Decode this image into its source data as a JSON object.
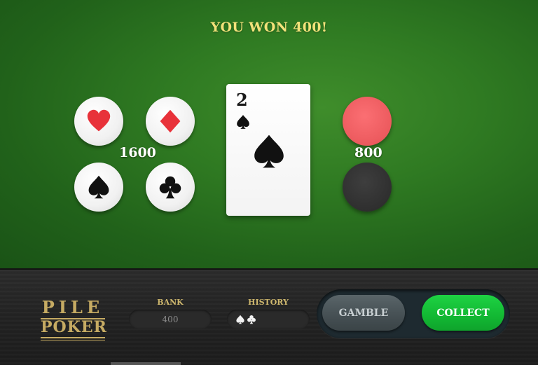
{
  "message": "YOU WON 400!",
  "suit_bet_value": "1600",
  "color_bet_value": "800",
  "suits": [
    {
      "name": "hearts",
      "icon": "heart-icon",
      "color": "#e8323a"
    },
    {
      "name": "diamonds",
      "icon": "diamond-icon",
      "color": "#e8323a"
    },
    {
      "name": "spades",
      "icon": "spade-icon",
      "color": "#111111"
    },
    {
      "name": "clubs",
      "icon": "club-icon",
      "color": "#111111"
    }
  ],
  "card": {
    "rank": "2",
    "suit": "spade-icon"
  },
  "colors": {
    "red": "#ec5a5e",
    "black": "#2f2f2f",
    "win_text": "#f2e27a",
    "gold": "#c6ab63",
    "collect_green": "#12b833"
  },
  "logo": {
    "line1": "PILE",
    "line2": "POKER"
  },
  "bank": {
    "label": "BANK",
    "value": "400"
  },
  "history": {
    "label": "HISTORY",
    "items": [
      "spade-icon",
      "club-icon"
    ]
  },
  "buttons": {
    "gamble": "GAMBLE",
    "collect": "COLLECT"
  }
}
